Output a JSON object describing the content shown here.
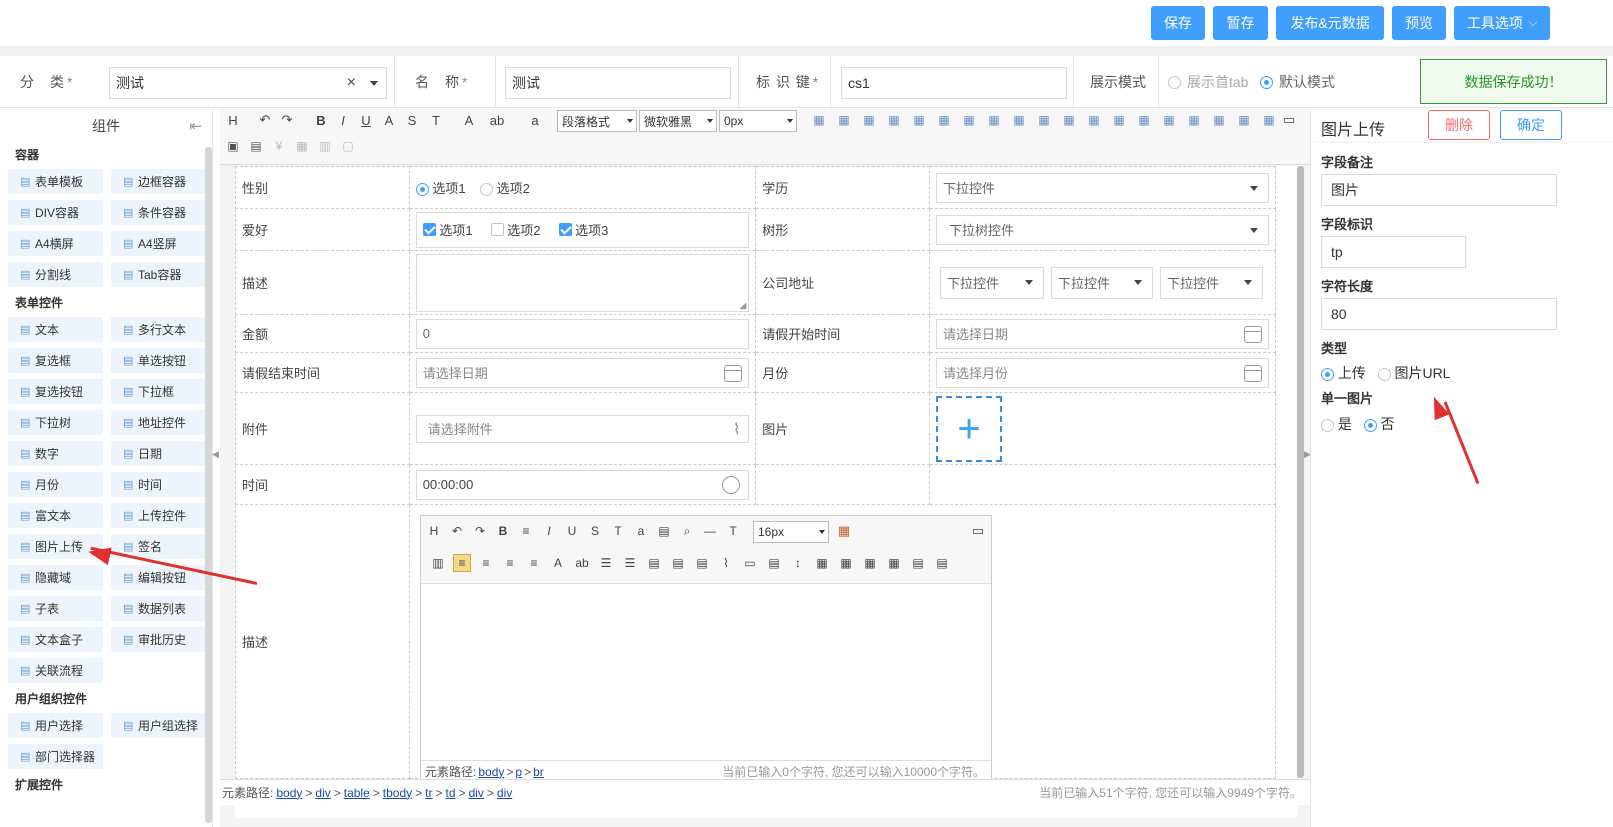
{
  "toolbar": {
    "save": "保存",
    "draft": "暂存",
    "publish": "发布&元数据",
    "preview": "预览",
    "tools": "工具选项"
  },
  "meta": {
    "category_label": "分　类",
    "category_value": "测试",
    "name_label": "名　称",
    "name_value": "测试",
    "key_label": "标 识 键",
    "key_value": "cs1",
    "mode_label": "展示模式",
    "mode_opt1": "展示首tab",
    "mode_opt2": "默认模式",
    "required_mark": "*"
  },
  "toast": "数据保存成功！",
  "left": {
    "title": "组件",
    "sections": [
      {
        "title": "容器",
        "items": [
          "表单模板",
          "边框容器",
          "DIV容器",
          "条件容器",
          "A4横屏",
          "A4竖屏",
          "分割线",
          "Tab容器"
        ]
      },
      {
        "title": "表单控件",
        "items": [
          "文本",
          "多行文本",
          "复选框",
          "单选按钮",
          "复选按钮",
          "下拉框",
          "下拉树",
          "地址控件",
          "数字",
          "日期",
          "月份",
          "时间",
          "富文本",
          "上传控件",
          "图片上传",
          "签名",
          "隐藏域",
          "编辑按钮",
          "子表",
          "数据列表",
          "文本盒子",
          "审批历史",
          "关联流程"
        ]
      },
      {
        "title": "用户组织控件",
        "items": [
          "用户选择",
          "用户组选择",
          "部门选择器"
        ]
      },
      {
        "title": "扩展控件",
        "items": []
      }
    ]
  },
  "editor": {
    "sel_para": "段落格式",
    "sel_font": "微软雅黑",
    "sel_size": "0px",
    "form": {
      "gender": "性别",
      "opt1": "选项1",
      "opt2": "选项2",
      "opt3": "选项3",
      "education": "学历",
      "dropdown": "下拉控件",
      "hobby": "爱好",
      "tree": "树形",
      "tree_dropdown": "下拉树控件",
      "desc": "描述",
      "company_addr": "公司地址",
      "amount": "金额",
      "amount_value": "0",
      "leave_start": "请假开始时间",
      "date_ph": "请选择日期",
      "leave_end": "请假结束时间",
      "month": "月份",
      "month_ph": "请选择月份",
      "attachment": "附件",
      "attach_ph": "请选择附件",
      "image": "图片",
      "time": "时间",
      "time_value": "00:00:00",
      "desc2": "描述"
    },
    "rich": {
      "font_size": "16px",
      "path_label": "元素路径:",
      "path": [
        "body",
        "p",
        "br"
      ],
      "count": "当前已输入0个字符, 您还可以输入10000个字符。"
    },
    "path_label": "元素路径:",
    "path": [
      "body",
      "div",
      "table",
      "tbody",
      "tr",
      "td",
      "div",
      "div"
    ],
    "count": "当前已输入51个字符, 您还可以输入9949个字符。"
  },
  "right": {
    "title": "图片上传",
    "delete": "删除",
    "confirm": "确定",
    "remark_label": "字段备注",
    "remark_value": "图片",
    "key_label": "字段标识",
    "key_value": "tp",
    "len_label": "字符长度",
    "len_value": "80",
    "type_label": "类型",
    "type_opt1": "上传",
    "type_opt2": "图片URL",
    "single_label": "单一图片",
    "single_yes": "是",
    "single_no": "否"
  },
  "colors": {
    "primary": "#409eff",
    "success": "#229922",
    "danger": "#f56c6c",
    "annotation": "#e03030"
  }
}
